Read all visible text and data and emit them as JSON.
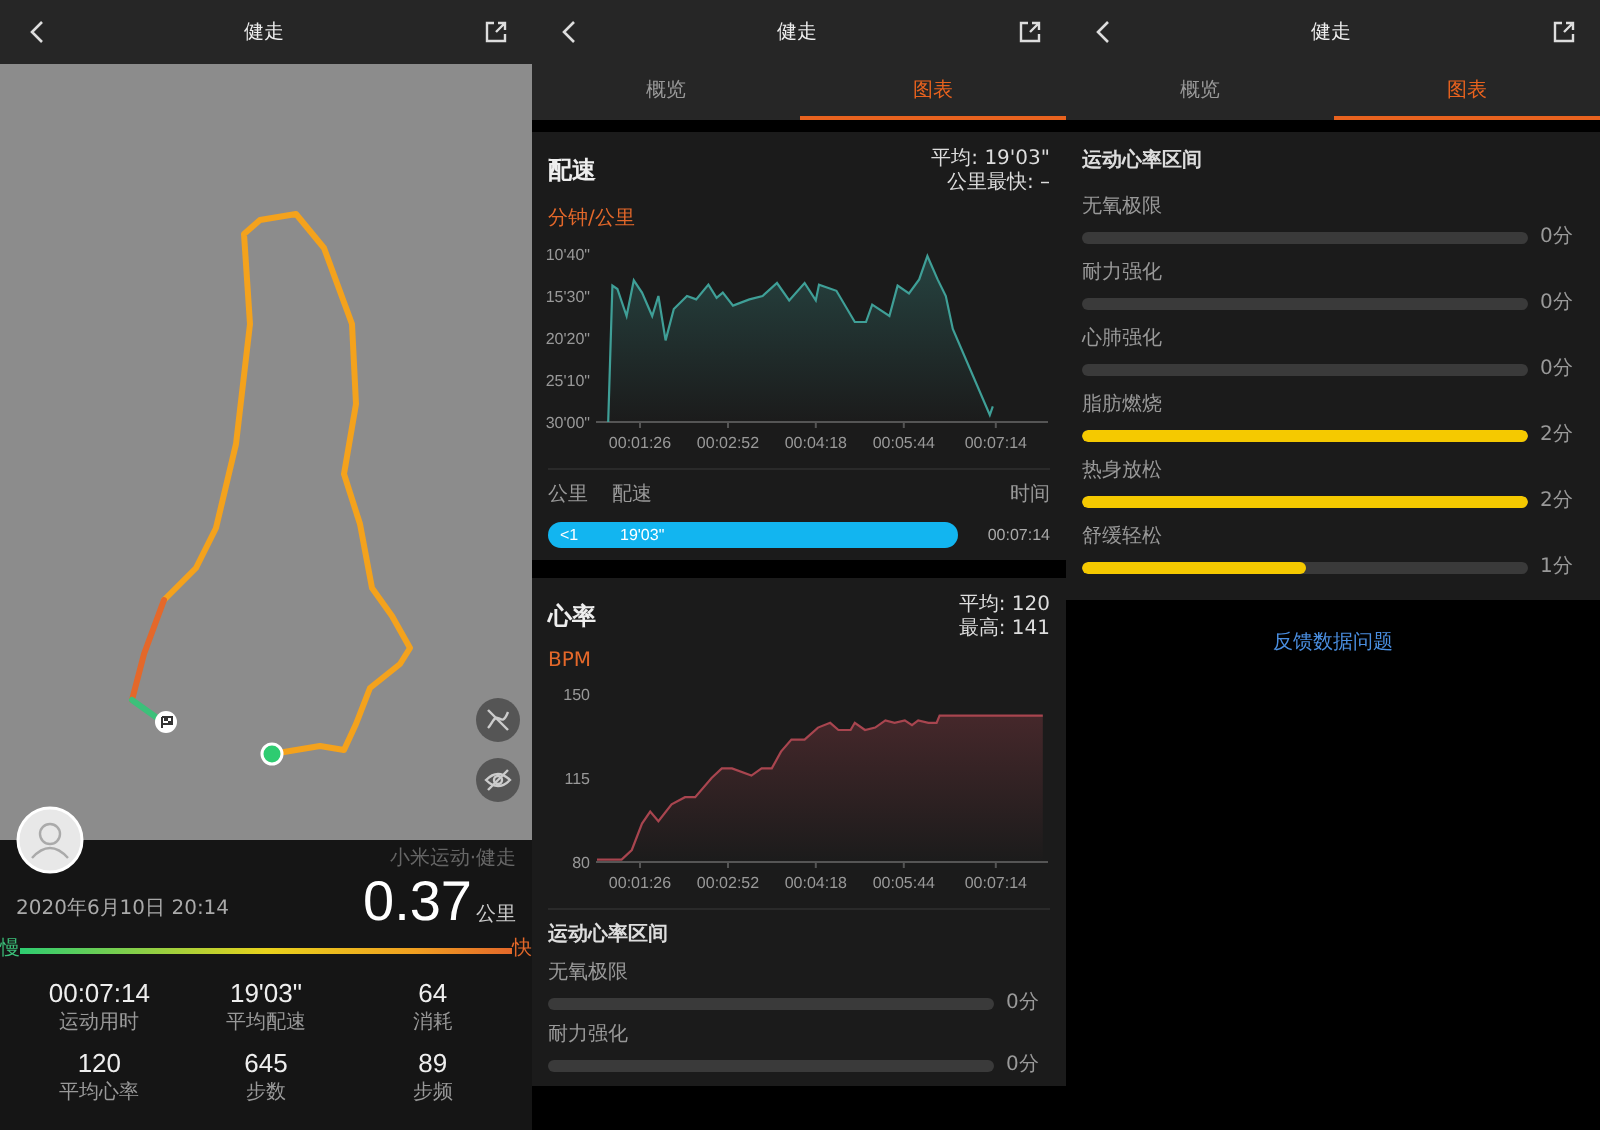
{
  "left_screen": {
    "header": {
      "title": "健走"
    },
    "summary": {
      "source": "小米运动·健走",
      "date": "2020年6月10日 20:14",
      "distance": "0.37",
      "distance_unit": "公里",
      "pace_legend": {
        "slow": "慢",
        "fast": "快"
      },
      "stats": [
        {
          "value": "00:07:14",
          "label": "运动用时"
        },
        {
          "value": "19'03\"",
          "label": "平均配速"
        },
        {
          "value": "64",
          "label": "消耗"
        },
        {
          "value": "120",
          "label": "平均心率"
        },
        {
          "value": "645",
          "label": "步数"
        },
        {
          "value": "89",
          "label": "步频"
        }
      ]
    }
  },
  "middle_screen": {
    "header": {
      "title": "健走"
    },
    "tabs": [
      {
        "label": "概览",
        "selected": false
      },
      {
        "label": "图表",
        "selected": true
      }
    ],
    "pace_card": {
      "title": "配速",
      "average": "平均: 19'03\"",
      "fastest_km": "公里最快: –",
      "unit": "分钟/公里",
      "y_axis_labels": [
        "10'40\"",
        "15'30\"",
        "20'20\"",
        "25'10\"",
        "30'00\""
      ],
      "x_axis_labels": [
        "00:01:26",
        "00:02:52",
        "00:04:18",
        "00:05:44",
        "00:07:14"
      ],
      "table": {
        "columns": [
          "公里",
          "配速",
          "时间"
        ],
        "rows": [
          {
            "km": "<1",
            "pace": "19'03\"",
            "time": "00:07:14"
          }
        ]
      }
    },
    "heart_card": {
      "title": "心率",
      "average": "平均: 120",
      "max": "最高: 141",
      "unit": "BPM",
      "chart_data": {
        "type": "area",
        "xlim": [
          43,
          485
        ],
        "ylim": [
          80,
          150
        ],
        "xticks": [
          {
            "value": 86,
            "label": "00:01:26"
          },
          {
            "value": 172,
            "label": "00:02:52"
          },
          {
            "value": 258,
            "label": "00:04:18"
          },
          {
            "value": 344,
            "label": "00:05:44"
          },
          {
            "value": 434,
            "label": "00:07:14"
          }
        ],
        "yticks": [
          80,
          115,
          150
        ],
        "x": [
          44,
          68,
          78,
          88,
          96,
          104,
          117,
          130,
          140,
          156,
          166,
          176,
          195,
          205,
          215,
          224,
          234,
          247,
          260,
          272,
          280,
          292,
          296,
          306,
          316,
          326,
          335,
          345,
          352,
          358,
          368,
          376,
          379,
          480
        ],
        "series": [
          {
            "color": "#a8454f",
            "values": [
              81,
              81,
              85,
              96,
              101,
              97,
              104,
              107,
              107,
              115,
              119,
              119,
              116,
              119,
              119,
              126,
              131,
              131,
              136,
              138,
              135,
              135,
              138,
              135,
              136,
              139,
              138,
              139,
              137,
              139,
              138,
              138,
              141,
              141
            ]
          }
        ]
      }
    },
    "zones": {
      "title": "运动心率区间",
      "items": [
        {
          "name": "无氧极限",
          "level": 0,
          "reading": "0分"
        },
        {
          "name": "耐力强化",
          "level": 0,
          "reading": "0分"
        }
      ]
    }
  },
  "right_screen": {
    "header": {
      "title": "健走"
    },
    "tabs": [
      {
        "label": "概览",
        "selected": false
      },
      {
        "label": "图表",
        "selected": true
      }
    ],
    "zones": {
      "title": "运动心率区间",
      "items": [
        {
          "name": "无氧极限",
          "level": 0,
          "reading": "0分"
        },
        {
          "name": "耐力强化",
          "level": 0,
          "reading": "0分"
        },
        {
          "name": "心肺强化",
          "level": 0,
          "reading": "0分"
        },
        {
          "name": "脂肪燃烧",
          "level": 1,
          "reading": "2分"
        },
        {
          "name": "热身放松",
          "level": 1,
          "reading": "2分"
        },
        {
          "name": "舒缓轻松",
          "level": 0.5,
          "reading": "1分"
        }
      ]
    },
    "feedback_link": "反馈数据问题"
  }
}
